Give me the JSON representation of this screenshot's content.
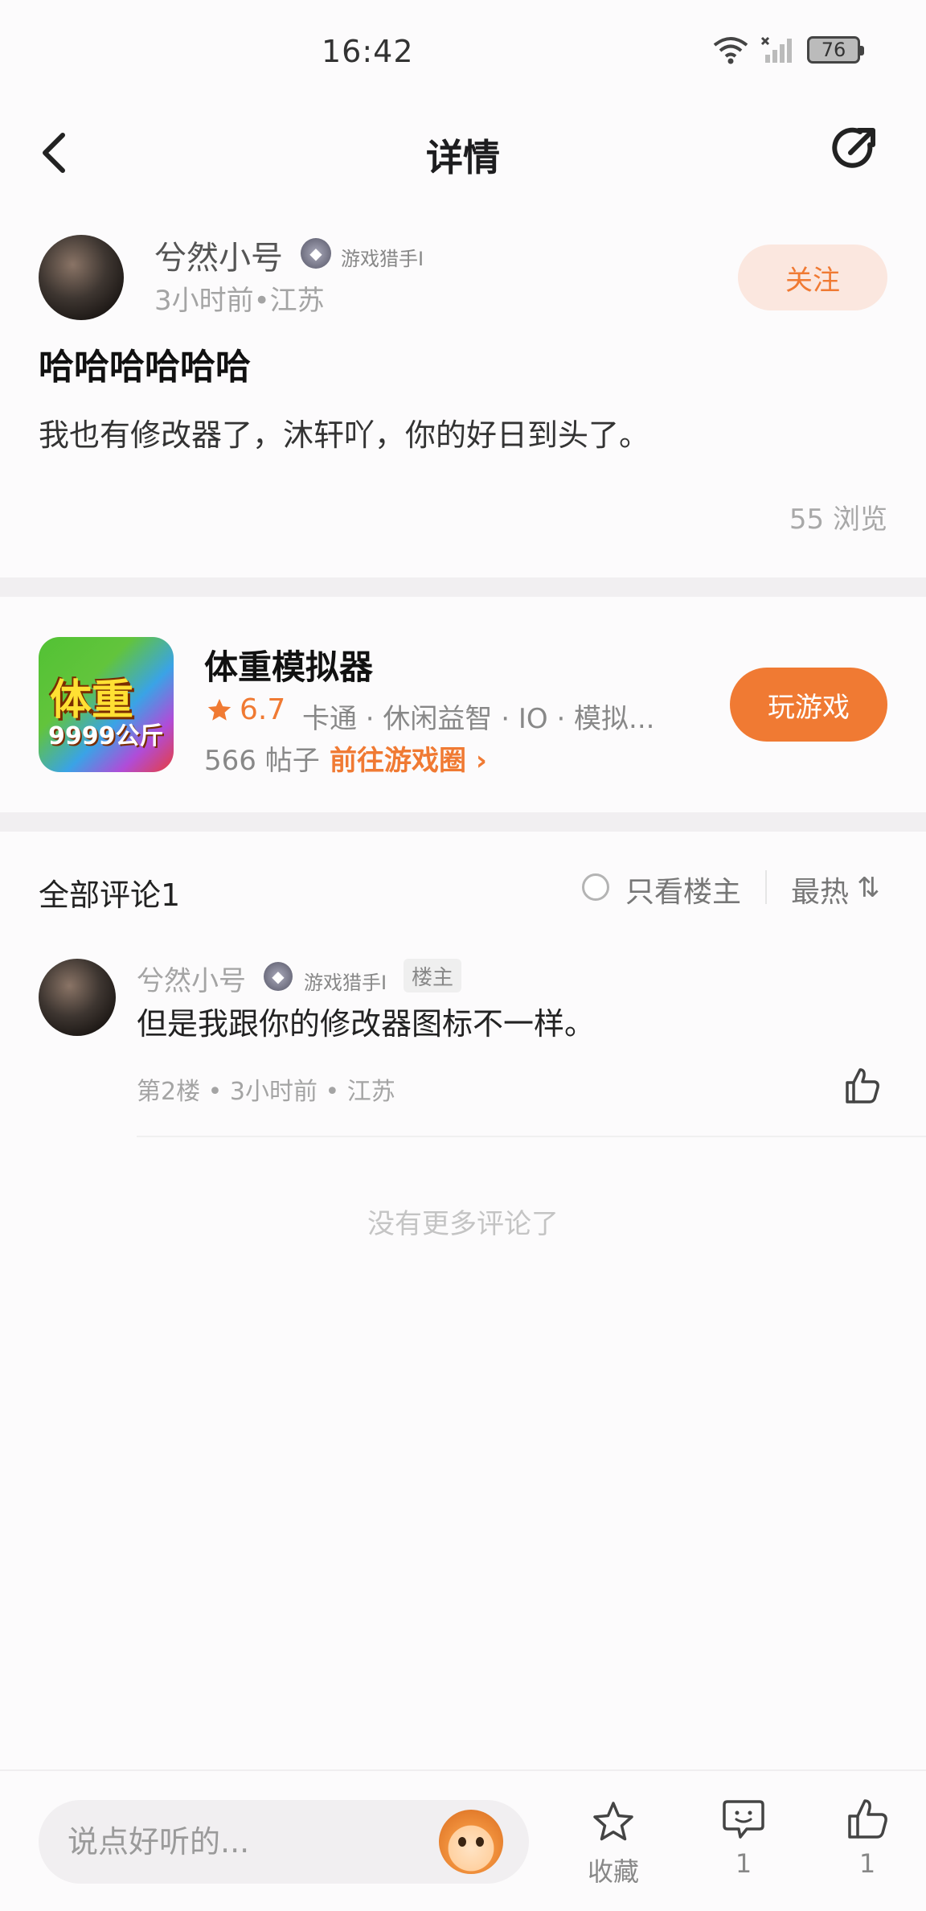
{
  "status_bar": {
    "time": "16:42",
    "battery": "76"
  },
  "nav": {
    "title": "详情"
  },
  "post": {
    "author": "兮然小号",
    "badge_label": "游戏猎手I",
    "meta": "3小时前•江苏",
    "follow_label": "关注",
    "title": "哈哈哈哈哈哈",
    "body": "我也有修改器了，沐轩吖，你的好日到头了。",
    "views": "55 浏览"
  },
  "game": {
    "icon_title": "体重",
    "icon_subtitle": "9999公斤",
    "name": "体重模拟器",
    "rating": "6.7",
    "tags": "卡通 · 休闲益智 · IO · 模拟...",
    "posts": "566 帖子",
    "circle_link": "前往游戏圈 ›",
    "play_label": "玩游戏"
  },
  "comments": {
    "title": "全部评论1",
    "only_op_label": "只看楼主",
    "sort_label": "最热",
    "sort_icon": "⇅",
    "items": [
      {
        "author": "兮然小号",
        "badge_label": "游戏猎手I",
        "op_tag": "楼主",
        "body": "但是我跟你的修改器图标不一样。",
        "meta": "第2楼 • 3小时前 • 江苏"
      }
    ],
    "no_more": "没有更多评论了"
  },
  "bottom_bar": {
    "input_placeholder": "说点好听的...",
    "favorite_label": "收藏",
    "comment_count": "1",
    "like_count": "1"
  },
  "colors": {
    "accent": "#f07a33",
    "follow_bg": "#fbe7df"
  }
}
